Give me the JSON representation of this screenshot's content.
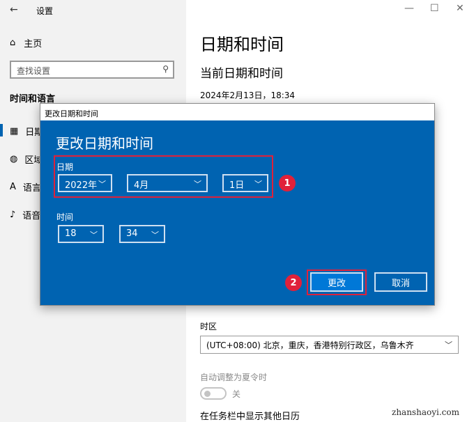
{
  "window": {
    "title": "设置"
  },
  "nav": {
    "home": "主页",
    "search_placeholder": "查找设置",
    "section": "时间和语言",
    "items": [
      {
        "label": "日期",
        "icon": "calendar-clock-icon"
      },
      {
        "label": "区域",
        "icon": "globe-icon"
      },
      {
        "label": "语言",
        "icon": "language-icon"
      },
      {
        "label": "语音",
        "icon": "microphone-icon"
      }
    ]
  },
  "main": {
    "title": "日期和时间",
    "subtitle": "当前日期和时间",
    "current": "2024年2月13日，18:34",
    "timezone_label": "时区",
    "timezone_value": "(UTC+08:00) 北京，重庆，香港特别行政区，乌鲁木齐",
    "dst_label": "自动调整为夏令时",
    "dst_state": "关",
    "taskbar_calendar": "在任务栏中显示其他日历"
  },
  "dialog": {
    "titlebar": "更改日期和时间",
    "heading": "更改日期和时间",
    "date_label": "日期",
    "year": "2022年",
    "month": "4月",
    "day": "1日",
    "time_label": "时间",
    "hour": "18",
    "minute": "34",
    "change_button": "更改",
    "cancel_button": "取消"
  },
  "annotations": {
    "badge1": "1",
    "badge2": "2",
    "accent": "#e0213a"
  },
  "watermark": "zhanshaoyi.com",
  "colors": {
    "accent": "#0063b1",
    "button": "#0078d7"
  }
}
